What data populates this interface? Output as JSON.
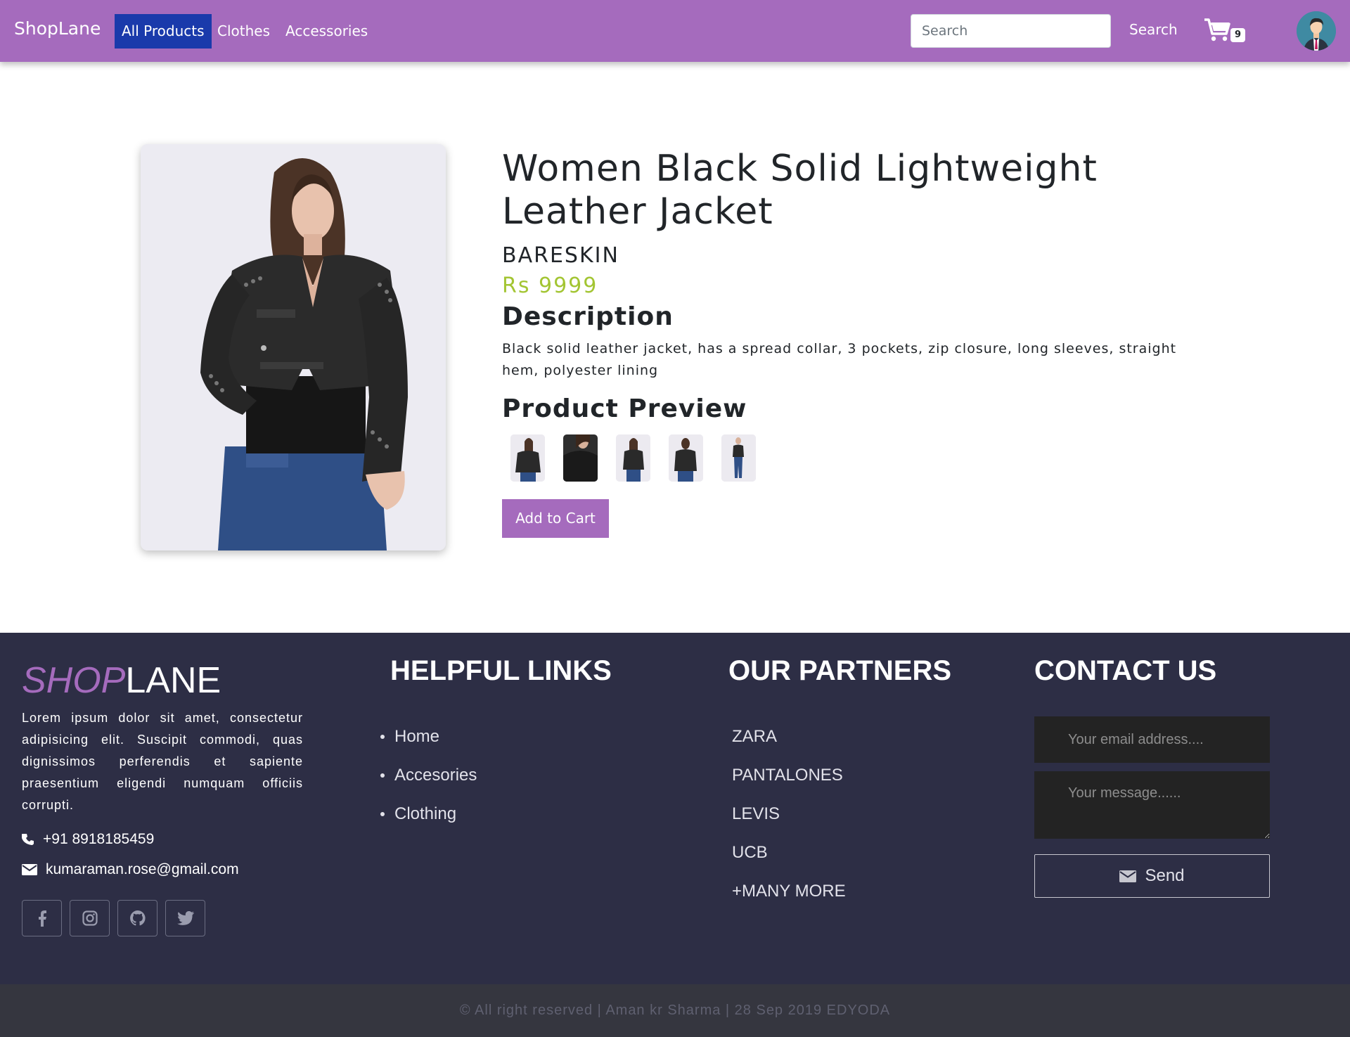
{
  "navbar": {
    "brand": "ShopLane",
    "links": [
      {
        "label": "All Products",
        "active": true
      },
      {
        "label": "Clothes",
        "active": false
      },
      {
        "label": "Accessories",
        "active": false
      }
    ],
    "search_placeholder": "Search",
    "search_label": "Search",
    "cart_count": "9",
    "cart_icon": "shopping-cart-icon",
    "avatar_icon": "user-avatar",
    "bg_color": "#a56bbd",
    "active_color": "#1a3aab"
  },
  "product": {
    "title": "Women Black Solid Lightweight Leather Jacket",
    "brand": "BARESKIN",
    "price": "Rs 9999",
    "price_color": "#a3c533",
    "description_heading": "Description",
    "description": "Black solid leather jacket, has a spread collar, 3 pockets, zip closure, long sleeves, straight hem, polyester lining",
    "preview_heading": "Product Preview",
    "preview_count": 5,
    "add_to_cart_label": "Add to Cart"
  },
  "footer": {
    "logo_shop": "SHOP",
    "logo_lane": "LANE",
    "about": "Lorem ipsum dolor sit amet, consectetur adipisicing elit. Suscipit commodi, quas dignissimos perferendis et sapiente praesentium eligendi numquam officiis corrupti.",
    "phone": "+91 8918185459",
    "email": "kumaraman.rose@gmail.com",
    "socials": [
      "facebook-icon",
      "instagram-icon",
      "github-icon",
      "twitter-icon"
    ],
    "helpful_heading": "HELPFUL LINKS",
    "helpful_links": [
      "Home",
      "Accesories",
      "Clothing"
    ],
    "partners_heading": "OUR PARTNERS",
    "partners": [
      "ZARA",
      "PANTALONES",
      "LEVIS",
      "UCB",
      "+MANY MORE"
    ],
    "contact_heading": "CONTACT US",
    "email_placeholder": "Your email address....",
    "message_placeholder": "Your message......",
    "send_label": "Send",
    "bg_color": "#2d2e45"
  },
  "copyright": "© All right reserved | Aman kr Sharma | 28 Sep 2019 EDYODA"
}
